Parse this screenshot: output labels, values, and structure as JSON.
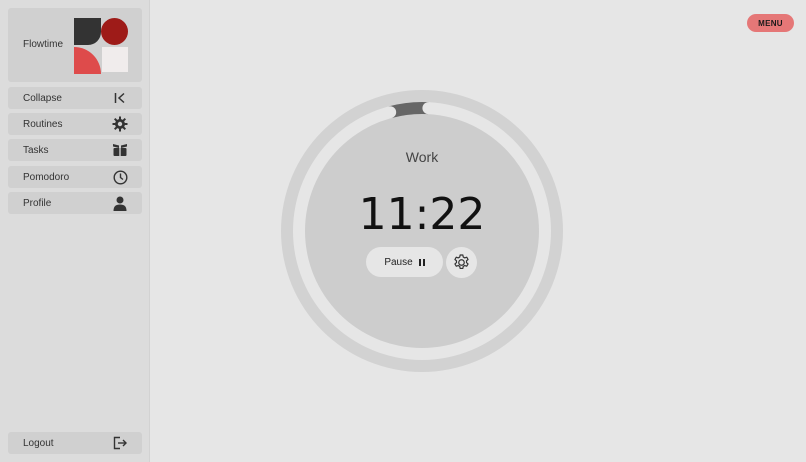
{
  "app": {
    "name": "Flowtime"
  },
  "sidebar": {
    "items": [
      {
        "label": "Collapse",
        "icon": "collapse-icon"
      },
      {
        "label": "Routines",
        "icon": "gear-icon"
      },
      {
        "label": "Tasks",
        "icon": "boxes-icon"
      },
      {
        "label": "Pomodoro",
        "icon": "clock-icon"
      },
      {
        "label": "Profile",
        "icon": "user-icon"
      }
    ],
    "logout": {
      "label": "Logout",
      "icon": "logout-icon"
    }
  },
  "header": {
    "menu_label": "MENU"
  },
  "timer": {
    "mode": "Work",
    "time": "11:22",
    "pause_label": "Pause",
    "progress_fraction": 0.05
  },
  "colors": {
    "accent": "#e57777",
    "logo_dark": "#333333",
    "logo_maroon": "#9e1b18",
    "logo_red": "#de4b4b",
    "logo_light": "#f0ecec",
    "ring_track": "#d0d0d0",
    "ring_progress": "#666666"
  }
}
